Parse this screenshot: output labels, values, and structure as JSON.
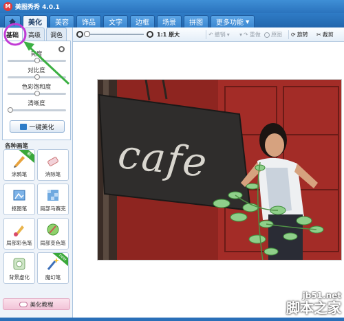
{
  "window": {
    "title": "美图秀秀 4.0.1"
  },
  "nav": {
    "tabs": [
      "美化",
      "美容",
      "饰品",
      "文字",
      "边框",
      "场景",
      "拼图"
    ],
    "more": "更多功能"
  },
  "subtabs": [
    "基础",
    "高级",
    "调色"
  ],
  "adjust": {
    "sliders": [
      {
        "label": "亮度",
        "value": 0.5
      },
      {
        "label": "对比度",
        "value": 0.5
      },
      {
        "label": "色彩饱和度",
        "value": 0.5
      },
      {
        "label": "清晰度",
        "value": 0.0
      }
    ],
    "auto_button": "一键美化"
  },
  "brushes": {
    "heading": "各种画笔",
    "items": [
      {
        "label": "涂鸦笔",
        "icon": "doodle-pen-icon",
        "badge": "新"
      },
      {
        "label": "消除笔",
        "icon": "eraser-pen-icon"
      },
      {
        "label": "抠图笔",
        "icon": "cutout-pen-icon"
      },
      {
        "label": "局部马赛克",
        "icon": "mosaic-icon"
      },
      {
        "label": "局部彩色笔",
        "icon": "color-pen-icon"
      },
      {
        "label": "局部变色笔",
        "icon": "recolor-pen-icon"
      },
      {
        "label": "背景虚化",
        "icon": "blur-background-icon"
      },
      {
        "label": "魔幻笔",
        "icon": "magic-pen-icon",
        "badge": "new"
      }
    ]
  },
  "tutorial_button": "美化教程",
  "toolbar": {
    "zoom_level": 0,
    "actual_size": "1:1 原大",
    "undo": "撤销",
    "redo": "重做",
    "original": "原图",
    "rotate": "旋转",
    "crop": "裁剪"
  },
  "photo": {
    "sign_text": "cafe"
  },
  "watermark": {
    "url": "jb51.net",
    "name": "脚本之家"
  },
  "colors": {
    "nav_blue": "#2a73bd",
    "annotation_purple": "#c23bd6",
    "annotation_green": "#3cb043",
    "door_red": "#a32c27"
  }
}
